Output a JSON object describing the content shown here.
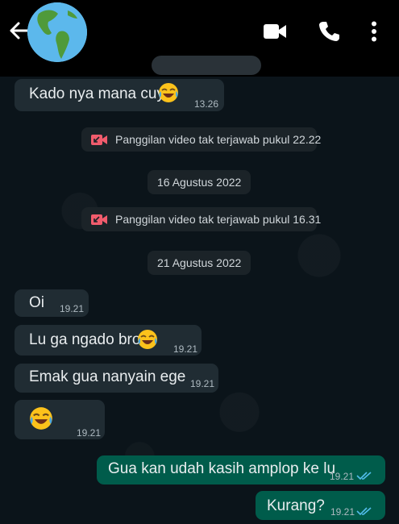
{
  "header": {
    "back_icon": "arrow-left-icon",
    "avatar_icon": "globe-icon",
    "video_call_icon": "video-camera-icon",
    "voice_call_icon": "phone-icon",
    "menu_icon": "more-vertical-icon"
  },
  "messages": [
    {
      "direction": "in",
      "text": "Kado nya mana cuy",
      "emoji": "face-with-tears-of-joy",
      "time": "13.26"
    },
    {
      "type": "system",
      "icon": "missed-video-call-icon",
      "text": "Panggilan video tak terjawab pukul 22.22"
    },
    {
      "type": "date",
      "text": "16 Agustus 2022"
    },
    {
      "type": "system",
      "icon": "missed-video-call-icon",
      "text": "Panggilan video tak terjawab pukul 16.31"
    },
    {
      "type": "date",
      "text": "21 Agustus 2022"
    },
    {
      "direction": "in",
      "text": "Oi",
      "time": "19.21"
    },
    {
      "direction": "in",
      "text": "Lu ga ngado bro",
      "emoji": "face-with-tears-of-joy",
      "time": "19.21"
    },
    {
      "direction": "in",
      "text": "Emak gua nanyain ege",
      "time": "19.21"
    },
    {
      "direction": "in",
      "text": "",
      "emoji": "face-with-tears-of-joy",
      "time": "19.21"
    },
    {
      "direction": "out",
      "text": "Gua kan udah kasih amplop ke lu",
      "time": "19.21",
      "status": "read-double-check-icon"
    },
    {
      "direction": "out",
      "text": "Kurang?",
      "time": "19.21",
      "status": "read-double-check-icon"
    }
  ],
  "colors": {
    "background": "#0b141a",
    "incoming_bubble": "#202c33",
    "outgoing_bubble": "#005c4b",
    "read_ticks": "#53bdeb",
    "missed_call": "#f15c6d"
  }
}
